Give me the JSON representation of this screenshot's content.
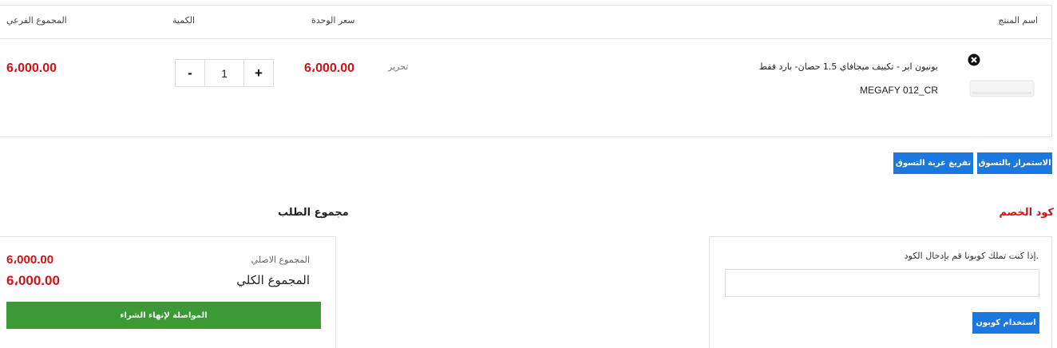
{
  "cart": {
    "columns": {
      "product_name": "اسم المنتج",
      "unit_price": "سعر الوحدة",
      "quantity": "الكمية",
      "subtotal": "المجموع الفرعي"
    },
    "item": {
      "name": "يونيون اير - تكييف ميجافاي 1.5 حصان- بارد فقط",
      "sku": "MEGAFY 012_CR",
      "edit_label": "تحرير",
      "unit_price": "6،000.00",
      "quantity": "1",
      "minus_label": "-",
      "plus_label": "+",
      "subtotal": "6،000.00"
    },
    "actions": {
      "continue_shopping": "الاستمرار بالتسوق",
      "clear_cart": "تفريغ عربة التسوق"
    }
  },
  "coupon": {
    "title": "كود الخصم",
    "hint": "إذا كنت تملك كوبونا قم بإدخال الكود.",
    "input_value": "",
    "apply_label": "استخدام كوبون"
  },
  "totals": {
    "title": "مجموع الطلب",
    "original_label": "المجموع الاصلي",
    "original_value": "6،000.00",
    "total_label": "المجموع الكلي",
    "total_value": "6،000.00",
    "checkout_label": "المواصلة لإنهاء الشراء"
  },
  "colors": {
    "accent_blue": "#1a78e0",
    "price_red": "#d0121a",
    "checkout_green": "#3b9a36"
  }
}
